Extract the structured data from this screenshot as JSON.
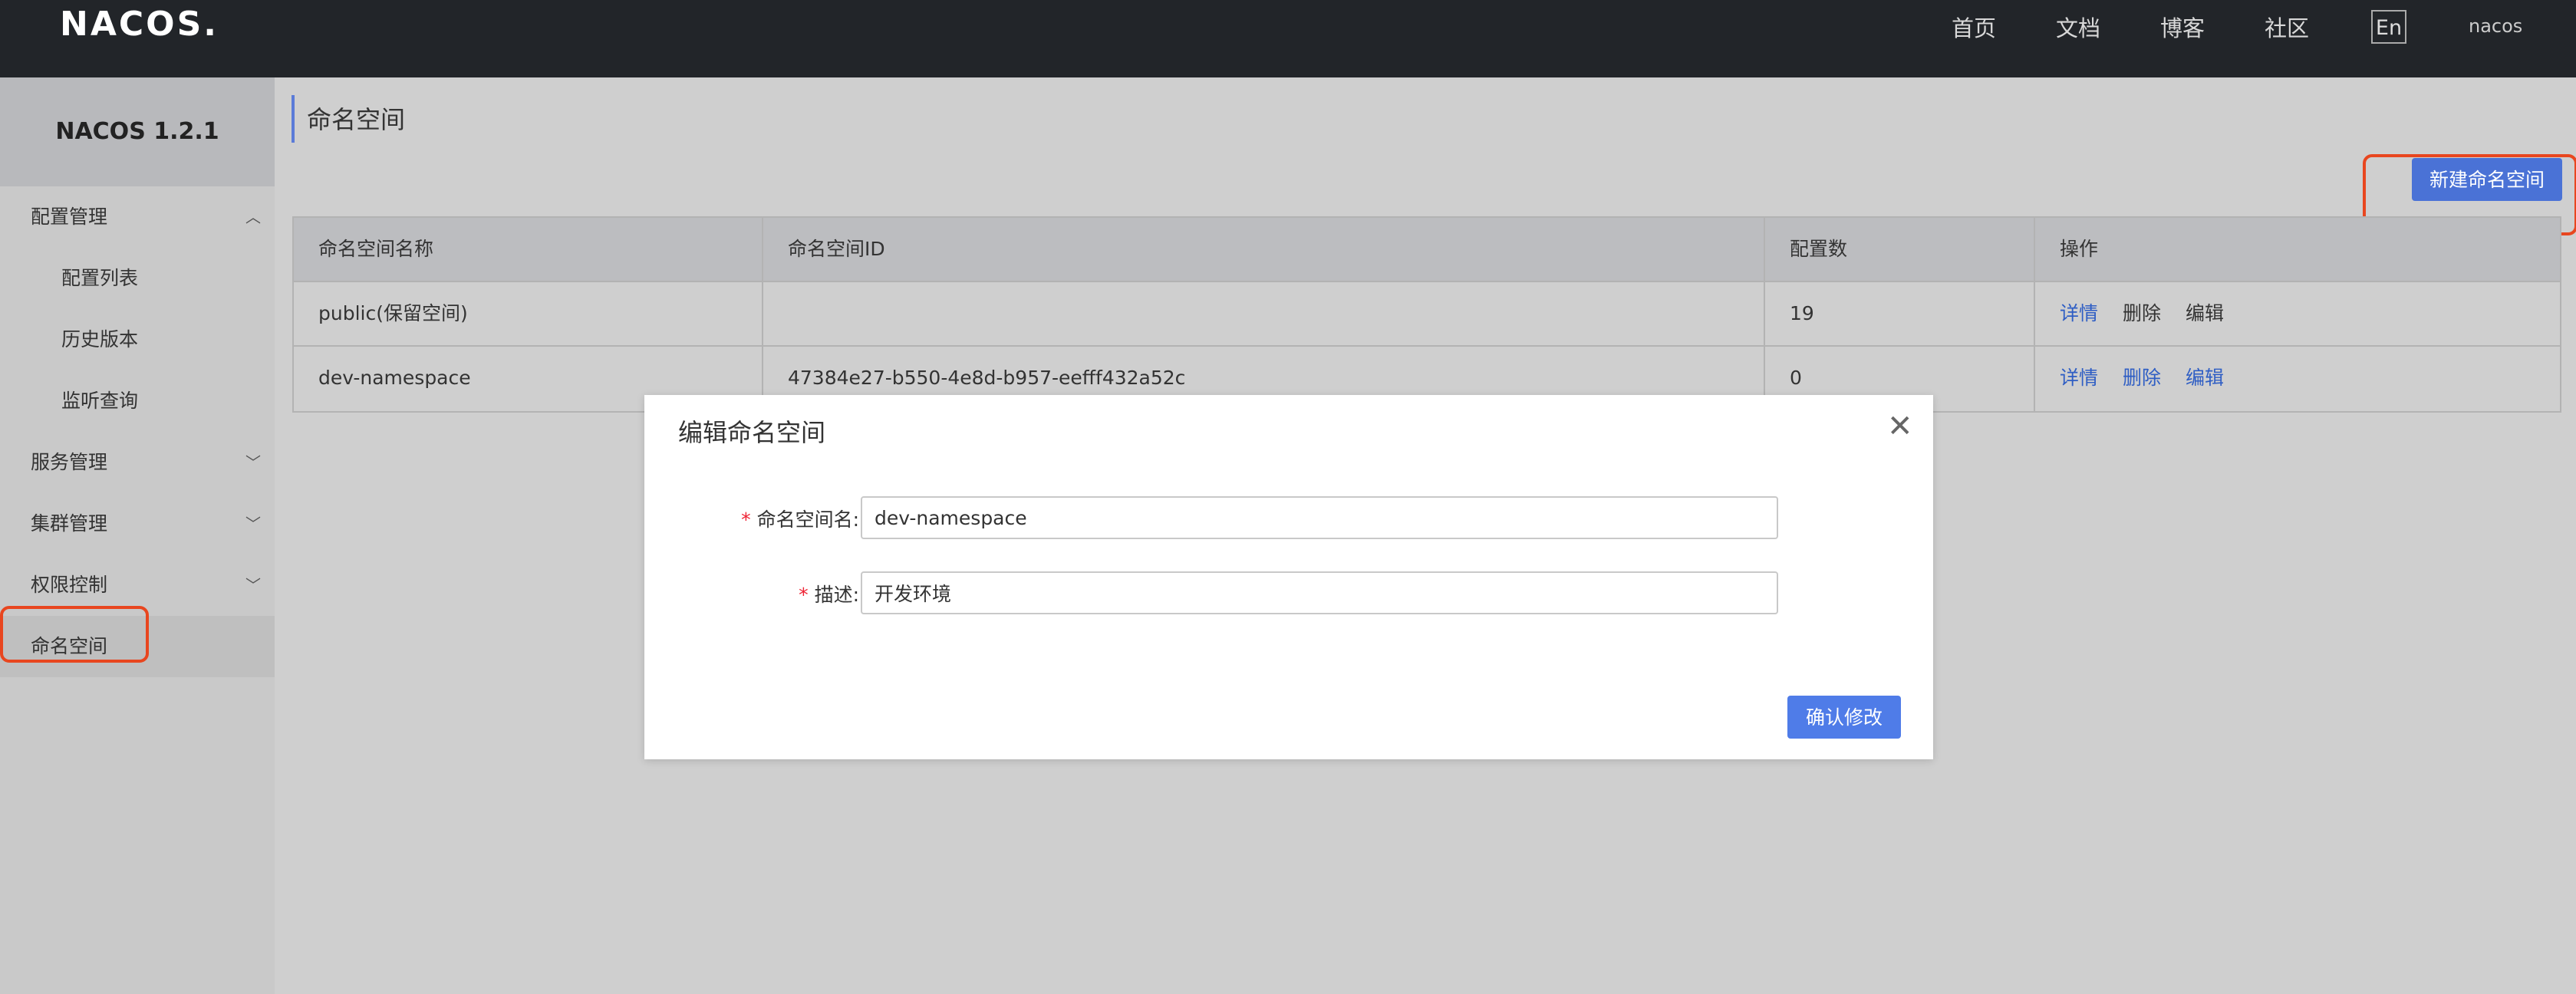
{
  "header": {
    "logo": "NACOS.",
    "nav": [
      "首页",
      "文档",
      "博客",
      "社区"
    ],
    "lang": "En",
    "user": "nacos"
  },
  "sidebar": {
    "version": "NACOS 1.2.1",
    "items": [
      {
        "label": "配置管理",
        "type": "group",
        "expanded": true
      },
      {
        "label": "配置列表",
        "type": "sub"
      },
      {
        "label": "历史版本",
        "type": "sub"
      },
      {
        "label": "监听查询",
        "type": "sub"
      },
      {
        "label": "服务管理",
        "type": "group",
        "expanded": false
      },
      {
        "label": "集群管理",
        "type": "group",
        "expanded": false
      },
      {
        "label": "权限控制",
        "type": "group",
        "expanded": false
      },
      {
        "label": "命名空间",
        "type": "item",
        "active": true
      }
    ]
  },
  "main": {
    "title": "命名空间",
    "new_button": "新建命名空间",
    "table": {
      "columns": [
        "命名空间名称",
        "命名空间ID",
        "配置数",
        "操作"
      ],
      "rows": [
        {
          "name": "public(保留空间)",
          "id": "",
          "count": "19",
          "actions": [
            "详情",
            "删除",
            "编辑"
          ]
        },
        {
          "name": "dev-namespace",
          "id": "47384e27-b550-4e8d-b957-eefff432a52c",
          "count": "0",
          "actions": [
            "详情",
            "删除",
            "编辑"
          ]
        }
      ]
    }
  },
  "modal": {
    "title": "编辑命名空间",
    "name_label": "命名空间名:",
    "name_value": "dev-namespace",
    "desc_label": "描述:",
    "desc_value": "开发环境",
    "confirm": "确认修改"
  },
  "colors": {
    "header_bg": "#222529",
    "accent": "#4a72d6",
    "highlight": "#e8461f"
  }
}
